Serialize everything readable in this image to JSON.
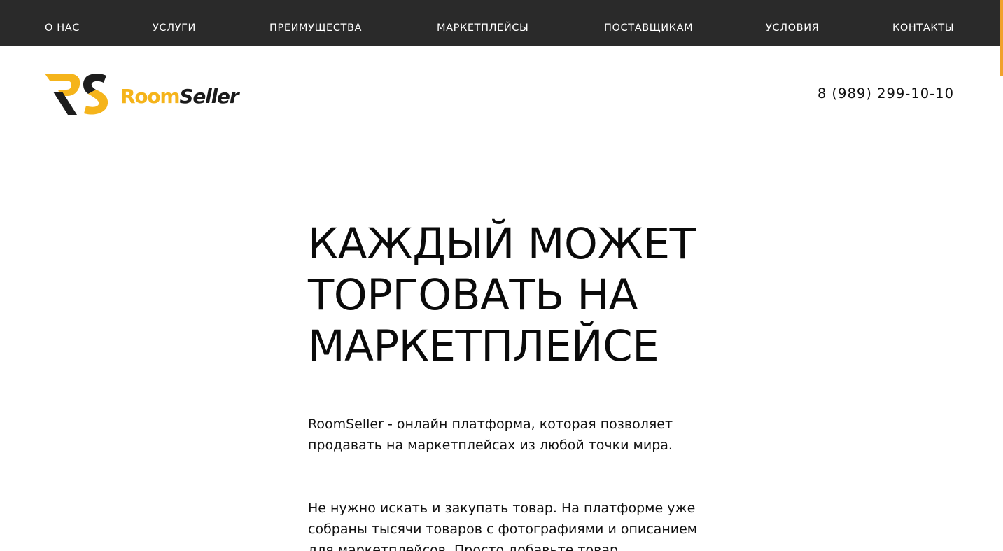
{
  "nav": {
    "items": [
      {
        "label": "О НАС"
      },
      {
        "label": "УСЛУГИ"
      },
      {
        "label": "ПРЕИМУЩЕСТВА"
      },
      {
        "label": "МАРКЕТПЛЕЙСЫ"
      },
      {
        "label": "ПОСТАВЩИКАМ"
      },
      {
        "label": "УСЛОВИЯ"
      },
      {
        "label": "КОНТАКТЫ"
      }
    ]
  },
  "header": {
    "logo": {
      "room": "Room",
      "seller": "Seller",
      "icon": "rs-monogram-icon"
    },
    "phone": "8 (989) 299-10-10"
  },
  "hero": {
    "title_lines": [
      "КАЖДЫЙ МОЖЕТ",
      "ТОРГОВАТЬ НА",
      "МАРКЕТПЛЕЙСЕ"
    ],
    "paragraph1_lines": [
      "RoomSeller - онлайн платформа, которая позволяет",
      "продавать на маркетплейсах из любой точки мира."
    ],
    "paragraph2_lines": [
      "Не нужно искать и закупать товар. На платформе уже",
      "собраны тысячи товаров с фотографиями и описанием",
      "для маркетплейсов. Просто добавьте товар"
    ]
  },
  "colors": {
    "nav_bg": "#2a2a2a",
    "accent": "#f5b41b",
    "scroll_indicator": "#f1a12b",
    "text": "#111111"
  }
}
